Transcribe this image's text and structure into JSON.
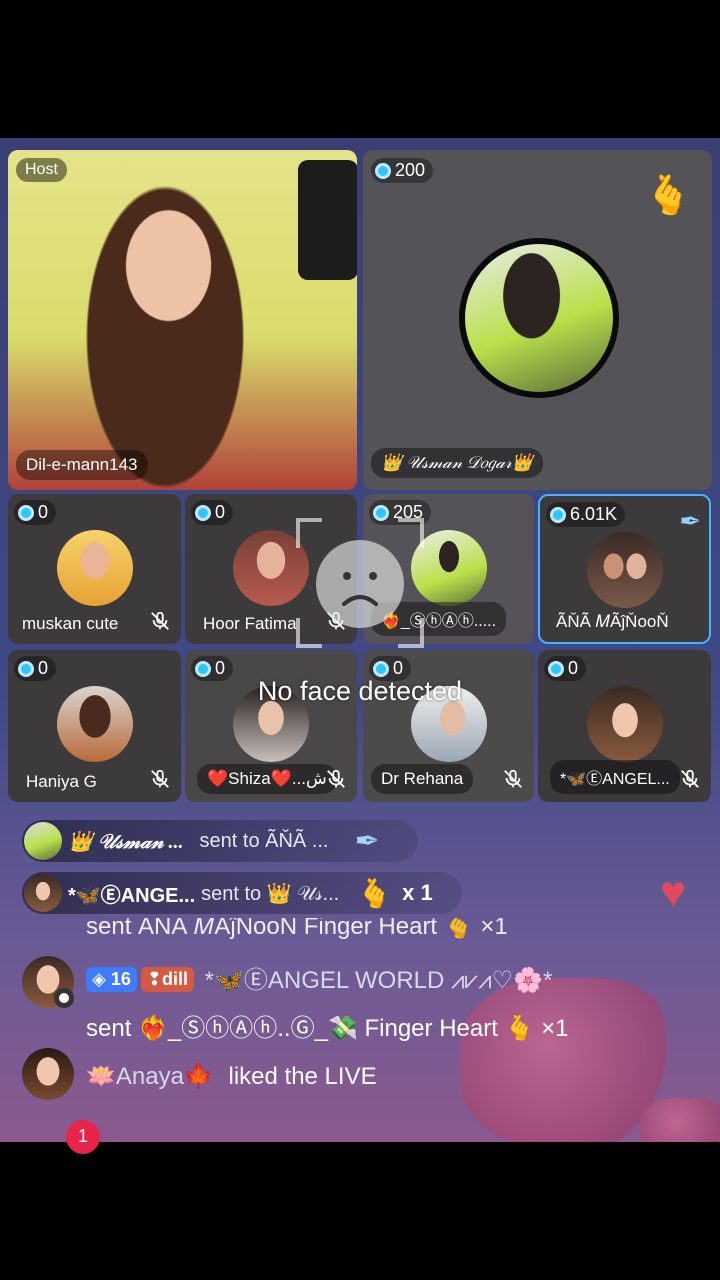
{
  "host": {
    "badge": "Host",
    "name": "Dil-e-mann143"
  },
  "guest_main": {
    "coins": "200",
    "name": "👑 𝒰𝓈𝓂𝒶𝓃 𝒟𝑜𝑔𝒶𝓇👑"
  },
  "seats_row1": [
    {
      "coins": "0",
      "name": "muskan cute"
    },
    {
      "coins": "0",
      "name": "Hoor Fatima"
    },
    {
      "coins": "205",
      "name": "❤️‍🔥_ⓈⓗⒶⓗ....."
    },
    {
      "coins": "6.01K",
      "name": "ÃŇÃ 𝑀ÃĵŇooŇ"
    }
  ],
  "seats_row2": [
    {
      "coins": "0",
      "name": "Haniya G"
    },
    {
      "coins": "0",
      "name": "❤️Shiza❤️...ش"
    },
    {
      "coins": "0",
      "name": "Dr Rehana"
    },
    {
      "coins": "0",
      "name": "*🦋ⒺANGEL..."
    }
  ],
  "overlay": {
    "no_face": "No face detected"
  },
  "gifts": [
    {
      "sender": "👑 𝒰𝓈𝓂𝒶𝓃 ...",
      "text": "sent to ÃŇÃ ..."
    },
    {
      "sender": "*🦋ⒺANGE...",
      "text": "sent to 👑 𝒰𝓈...",
      "count": "x 1"
    }
  ],
  "chat": {
    "partial_line": "sent ÃŇÃ 𝑀ÃĵŇooŇ Finger Heart 🫰 ×1",
    "msg1": {
      "level": "16",
      "fan_badge": "dill",
      "user": "*🦋ⒺANGEL WORLD ⩘⩗⩘♡🌸*",
      "text": "sent ❤️‍🔥_ⓈⓗⒶⓗ..Ⓖ_💸 Finger Heart 🫰 ×1"
    },
    "msg2": {
      "user": "🪷Anaya🍁",
      "text": "liked the LIVE"
    }
  },
  "notification_count": "1",
  "colors": {
    "accent": "#2ec6ff",
    "selected_border": "#45b4ff",
    "badge_red": "#e8244b"
  }
}
